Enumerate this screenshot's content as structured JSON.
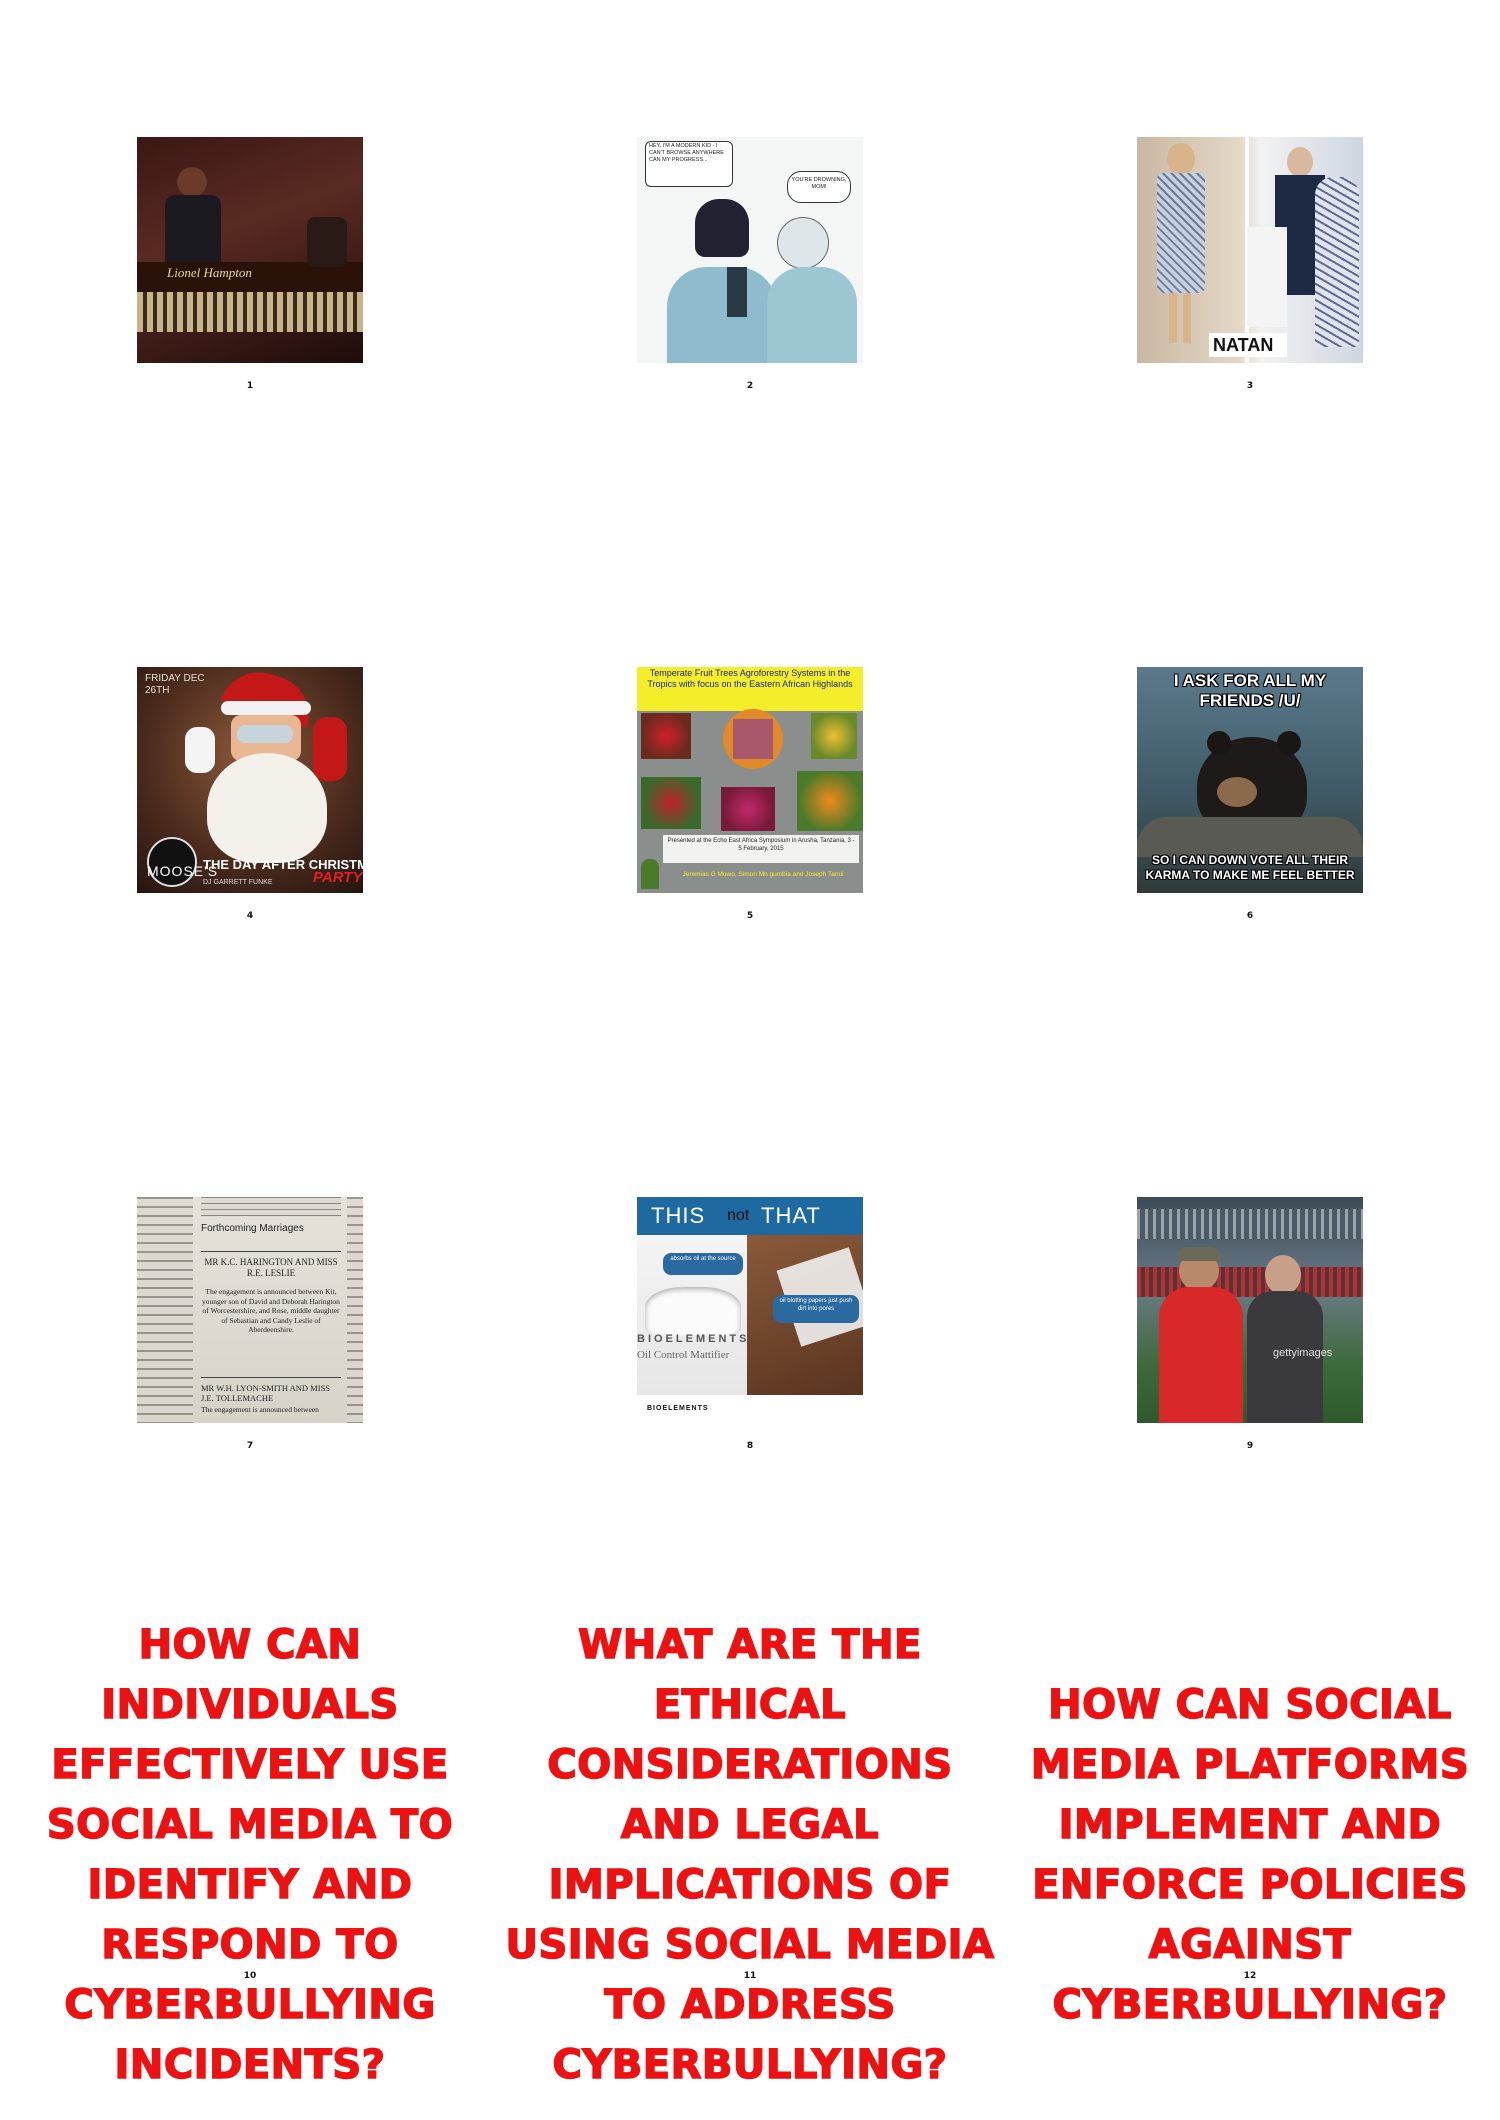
{
  "tiles": [
    {
      "number": "1",
      "kind": "image",
      "name": "jazz-vibraphone-photo",
      "tone": "#3a1814",
      "caption": "Lionel Hampton"
    },
    {
      "number": "2",
      "kind": "image",
      "name": "phone-comic-drawing",
      "tone": "#f4f6f6",
      "bubble_left": "HEY, I'M A MODERN KID - I CAN'T BROWSE ANYWHERE CAN MY PROGRESS...",
      "bubble_right": "YOU'RE DROWNING, MOM!"
    },
    {
      "number": "3",
      "kind": "image",
      "name": "fashion-dress-photo",
      "tone": "#e3d7c6",
      "caption": "NATAN"
    },
    {
      "number": "4",
      "kind": "image",
      "name": "santa-party-flyer",
      "tone": "#4a2a1c",
      "date": "FRIDAY DEC 26TH",
      "title": "THE DAY AFTER CHRISTMAS",
      "party": "PARTY",
      "venue": "MOOSE'S",
      "dj": "DJ GARRETT FUNKE"
    },
    {
      "number": "5",
      "kind": "image",
      "name": "agroforestry-slide",
      "tone": "#8a8e8c",
      "heading": "Temperate Fruit Trees Agroforestry Systems in the Tropics with focus on the Eastern African Highlands",
      "presented": "Presented at the Echo East Africa Symposium in Arusha, Tanzania, 3 - 5 February, 2015",
      "authors": "Jeremias G Mowo, Simon Mn gumbia and Joseph Tanui"
    },
    {
      "number": "6",
      "kind": "image",
      "name": "confession-bear-meme",
      "tone": "#3f5a66",
      "top_text": "I ASK FOR ALL MY FRIENDS /U/",
      "bottom_text": "SO I CAN DOWN VOTE ALL THEIR KARMA TO MAKE ME FEEL BETTER"
    },
    {
      "number": "7",
      "kind": "image",
      "name": "newspaper-engagement-notice",
      "tone": "#e6e2da",
      "section": "Forthcoming Marriages",
      "names": "MR K.C. HARINGTON AND MISS R.E. LESLIE",
      "body": "The engagement is announced between Kit, younger son of David and Deborah Harington of Worcestershire, and Rose, middle daughter of Sebastian and Candy Leslie of Aberdeenshire.",
      "names2": "MR W.H. LYON-SMITH AND MISS J.E. TOLLEMACHE",
      "body2": "The engagement is announced between"
    },
    {
      "number": "8",
      "kind": "image",
      "name": "skincare-ad",
      "tone": "#ffffff",
      "head_this": "THIS",
      "head_not": "not",
      "head_that": "THAT",
      "bubble1": "absorbs oil at the source",
      "bubble2": "oil blotting papers just push dirt into pores",
      "brand": "BIOELEMENTS",
      "product": "Oil Control Mattifier",
      "footer": "BIOELEMENTS"
    },
    {
      "number": "9",
      "kind": "image",
      "name": "stadium-players-photo",
      "tone": "#3c6a3a",
      "watermark": "gettyimages"
    },
    {
      "number": "10",
      "kind": "question",
      "text": "HOW CAN INDIVIDUALS EFFECTIVELY USE SOCIAL MEDIA TO IDENTIFY AND RESPOND TO CYBERBULLYING INCIDENTS?"
    },
    {
      "number": "11",
      "kind": "question",
      "text": "WHAT ARE THE ETHICAL CONSIDERATIONS AND LEGAL IMPLICATIONS OF USING SOCIAL MEDIA TO ADDRESS CYBERBULLYING?"
    },
    {
      "number": "12",
      "kind": "question",
      "text": "HOW CAN SOCIAL MEDIA PLATFORMS IMPLEMENT AND ENFORCE POLICIES AGAINST CYBERBULLYING?"
    }
  ]
}
